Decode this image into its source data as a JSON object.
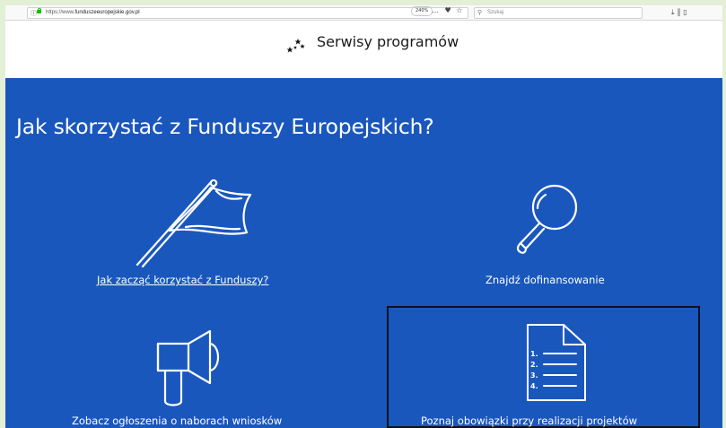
{
  "browser": {
    "url_prefix": "https://www.",
    "url_domain": "funduszeeuropejskie.gov.pl",
    "zoom": "240%",
    "more_icon": "…",
    "search_placeholder": "Szukaj"
  },
  "header": {
    "title": "Serwisy programów"
  },
  "main": {
    "title": "Jak skorzystać z Funduszy Europejskich?",
    "tiles": [
      {
        "label": "Jak zacząć korzystać z Funduszy?",
        "icon": "flag-icon",
        "link": true
      },
      {
        "label": "Znajdź dofinansowanie",
        "icon": "magnifier-icon",
        "link": false
      },
      {
        "label": "Zobacz ogłoszenia o naborach wniosków",
        "icon": "megaphone-icon",
        "link": false
      },
      {
        "label": "Poznaj obowiązki przy realizacji projektów",
        "icon": "document-list-icon",
        "link": false
      }
    ],
    "document_numbers": [
      "1.",
      "2.",
      "3.",
      "4."
    ]
  },
  "colors": {
    "background": "#1a57bd",
    "text": "#ffffff"
  }
}
